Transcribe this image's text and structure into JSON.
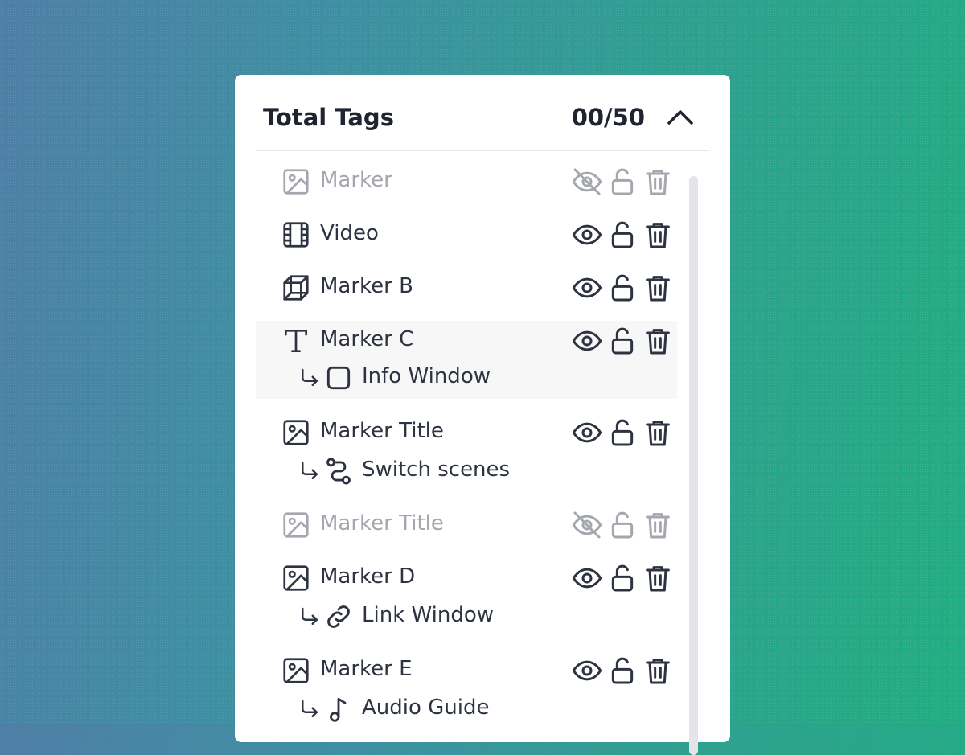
{
  "panel": {
    "title": "Total Tags",
    "count": "00/50",
    "collapse_icon": "chevron-up-icon"
  },
  "colors": {
    "active": "#2d3340",
    "disabled": "#a4a7ad",
    "highlight_row": "#f7f7f8"
  },
  "tags": [
    {
      "label": "Marker",
      "icon": "image-icon",
      "visible": false,
      "disabled": true
    },
    {
      "label": "Video",
      "icon": "film-icon",
      "visible": true,
      "disabled": false
    },
    {
      "label": "Marker B",
      "icon": "cube-icon",
      "visible": true,
      "disabled": false
    },
    {
      "label": "Marker C",
      "icon": "text-icon",
      "visible": true,
      "disabled": false,
      "highlighted": true,
      "child": {
        "label": "Info Window",
        "icon": "square-icon"
      }
    },
    {
      "label": "Marker Title",
      "icon": "image-icon",
      "visible": true,
      "disabled": false,
      "child": {
        "label": "Switch scenes",
        "icon": "route-icon"
      }
    },
    {
      "label": "Marker Title",
      "icon": "image-icon",
      "visible": false,
      "disabled": true
    },
    {
      "label": "Marker D",
      "icon": "image-icon",
      "visible": true,
      "disabled": false,
      "child": {
        "label": "Link Window",
        "icon": "link-icon"
      }
    },
    {
      "label": "Marker E",
      "icon": "image-icon",
      "visible": true,
      "disabled": false,
      "child": {
        "label": "Audio Guide",
        "icon": "music-note-icon"
      }
    }
  ]
}
